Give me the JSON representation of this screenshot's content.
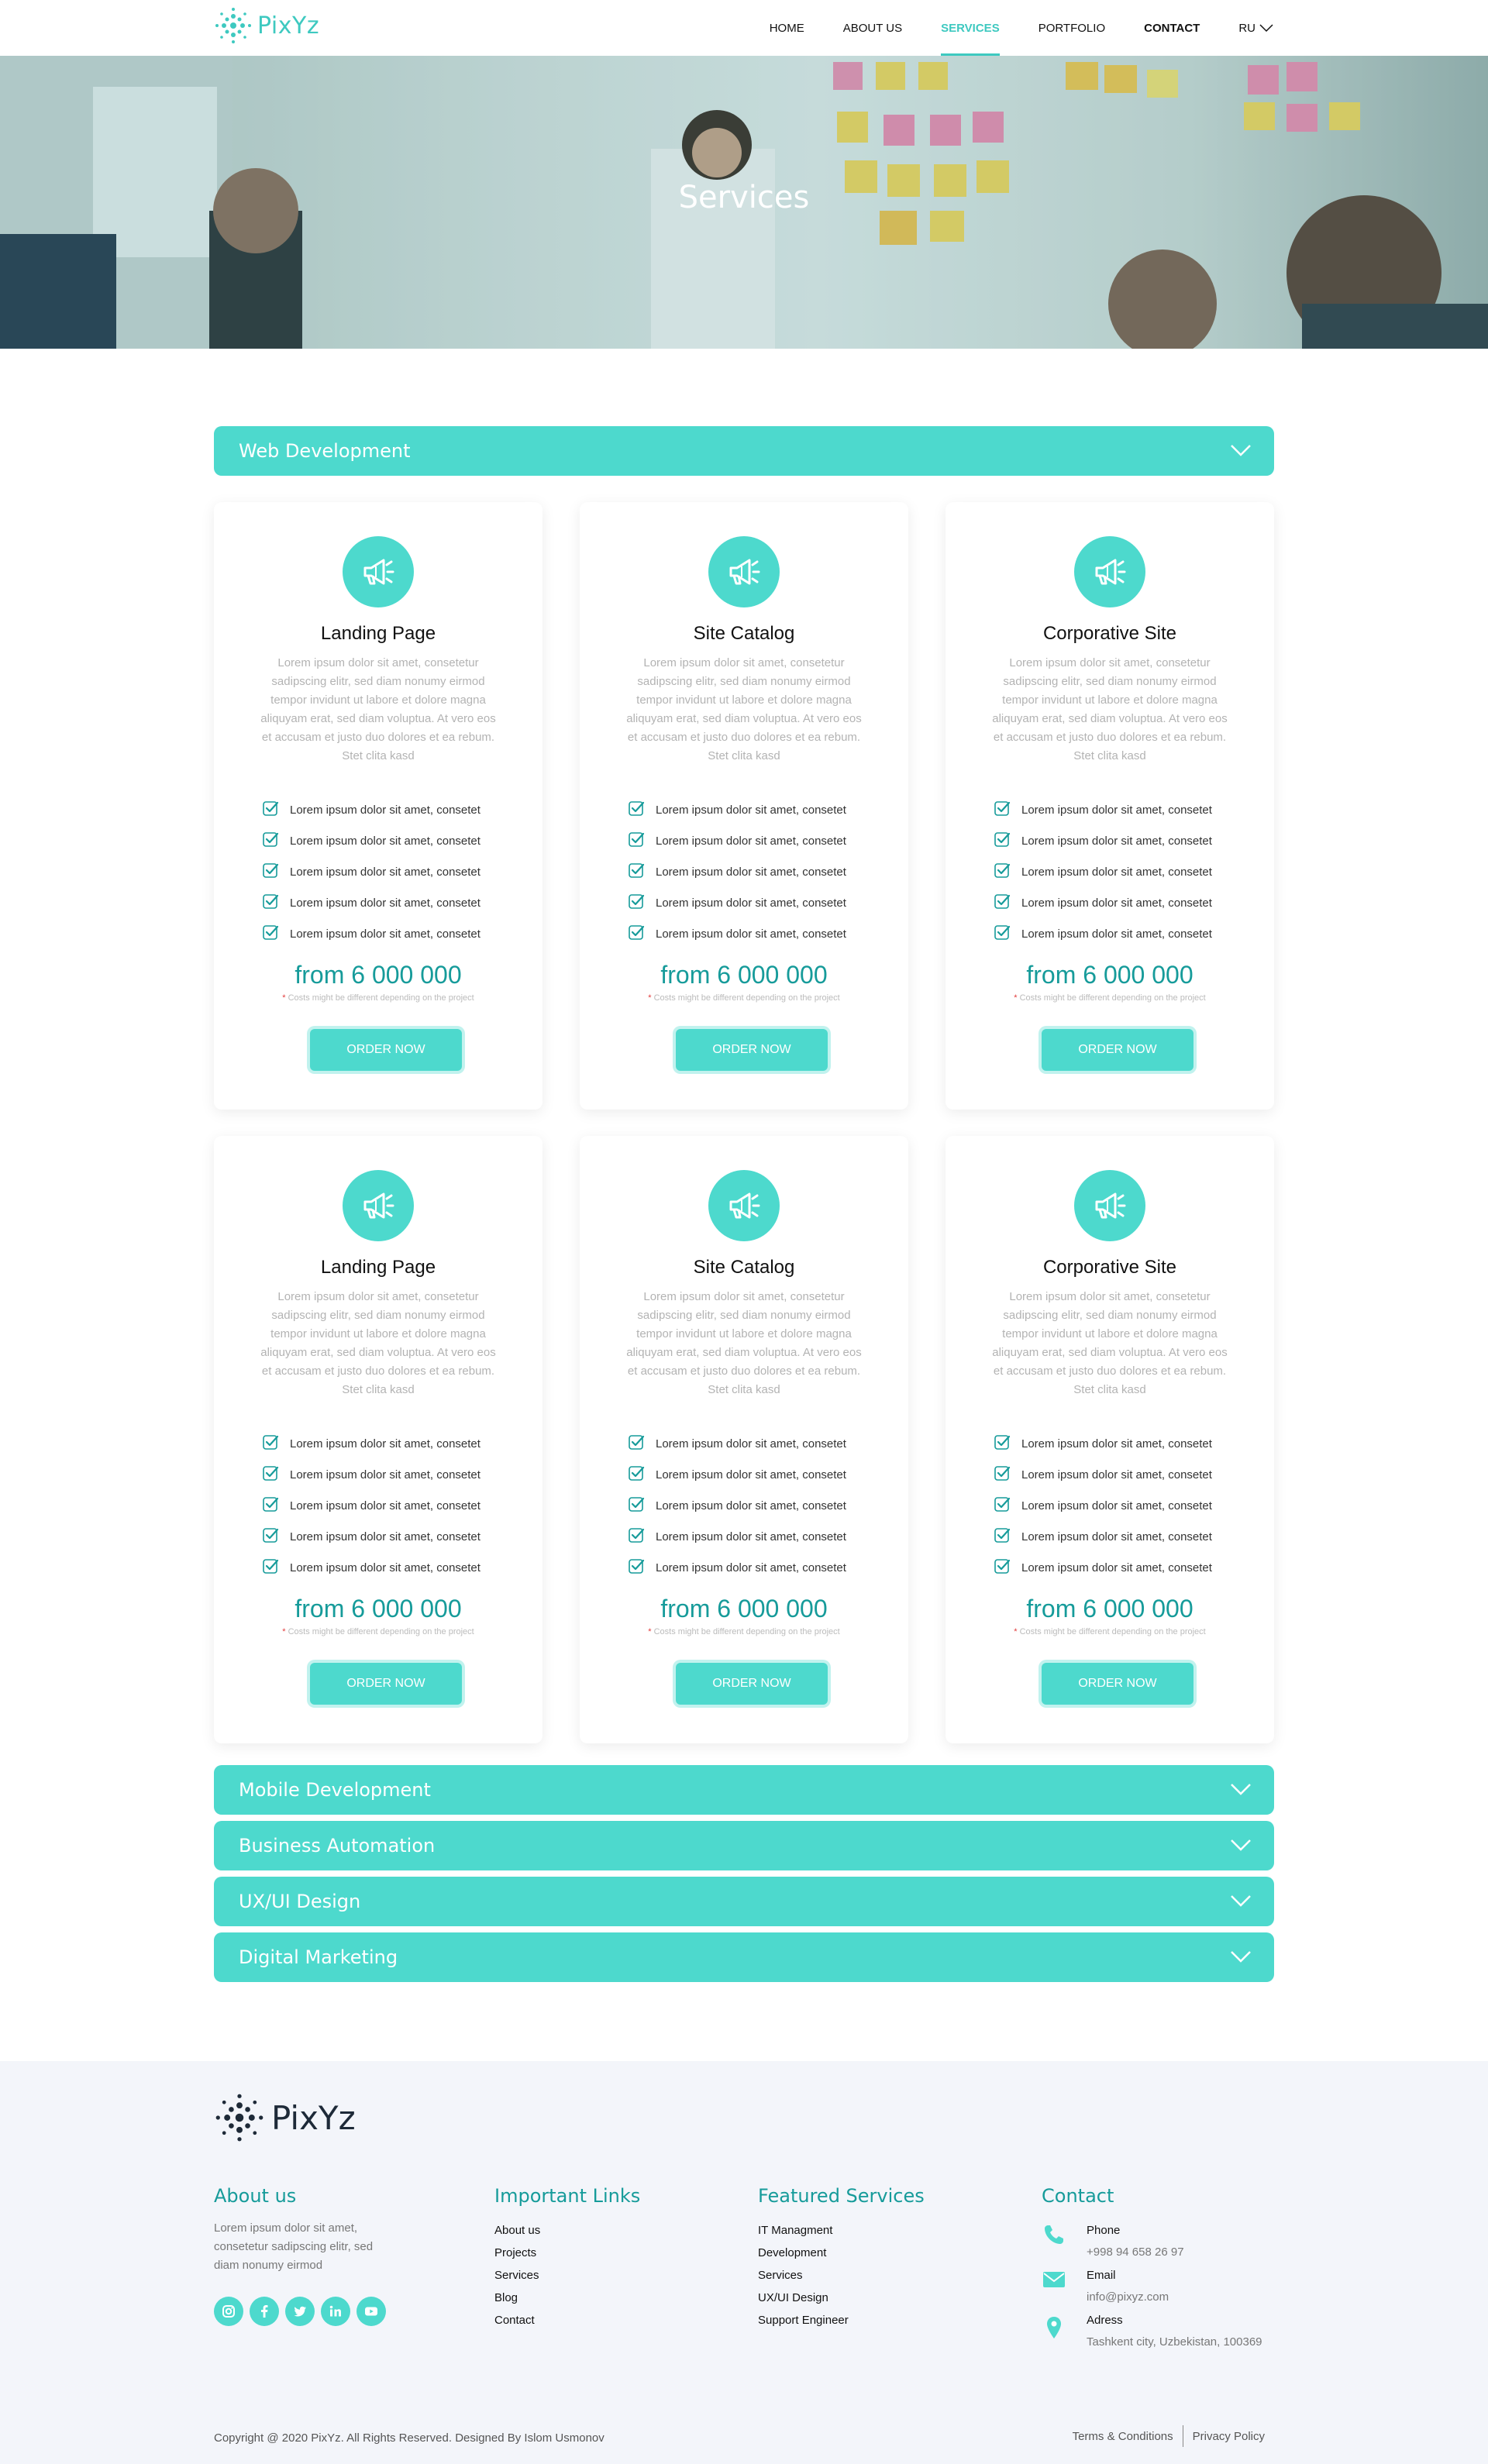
{
  "brand": {
    "name": "PixYz",
    "accent": "#4dd9cd",
    "accent_dark": "#169b9a"
  },
  "nav": {
    "items": [
      {
        "label": "HOME"
      },
      {
        "label": "ABOUT US"
      },
      {
        "label": "SERVICES"
      },
      {
        "label": "PORTFOLIO"
      },
      {
        "label": "CONTACT"
      }
    ],
    "active": "SERVICES",
    "lang": "RU"
  },
  "hero": {
    "title": "Services"
  },
  "sections": [
    {
      "title": "Web Development",
      "expanded": true
    },
    {
      "title": "Mobile Development",
      "expanded": false
    },
    {
      "title": "Business Automation",
      "expanded": false
    },
    {
      "title": "UX/UI Design",
      "expanded": false
    },
    {
      "title": "Digital Marketing",
      "expanded": false
    }
  ],
  "cards": [
    {
      "title": "Landing Page",
      "icon": "megaphone-icon",
      "desc": "Lorem ipsum dolor sit amet, consetetur sadipscing elitr, sed diam nonumy eirmod tempor invidunt ut labore et dolore magna aliquyam erat, sed diam voluptua. At vero eos et accusam et justo duo dolores et ea rebum. Stet clita kasd",
      "features": [
        "Lorem ipsum dolor sit amet, consetet",
        "Lorem ipsum dolor sit amet, consetet",
        "Lorem ipsum dolor sit amet, consetet",
        "Lorem ipsum dolor sit amet, consetet",
        "Lorem ipsum dolor sit amet, consetet"
      ],
      "price": "from 6 000 000",
      "note": "Costs might be different depending on the project",
      "button": "ORDER NOW"
    },
    {
      "title": "Site Catalog",
      "icon": "megaphone-icon",
      "desc": "Lorem ipsum dolor sit amet, consetetur sadipscing elitr, sed diam nonumy eirmod tempor invidunt ut labore et dolore magna aliquyam erat, sed diam voluptua. At vero eos et accusam et justo duo dolores et ea rebum. Stet clita kasd",
      "features": [
        "Lorem ipsum dolor sit amet, consetet",
        "Lorem ipsum dolor sit amet, consetet",
        "Lorem ipsum dolor sit amet, consetet",
        "Lorem ipsum dolor sit amet, consetet",
        "Lorem ipsum dolor sit amet, consetet"
      ],
      "price": "from 6 000 000",
      "note": "Costs might be different depending on the project",
      "button": "ORDER NOW"
    },
    {
      "title": "Corporative Site",
      "icon": "megaphone-icon",
      "desc": "Lorem ipsum dolor sit amet, consetetur sadipscing elitr, sed diam nonumy eirmod tempor invidunt ut labore et dolore magna aliquyam erat, sed diam voluptua. At vero eos et accusam et justo duo dolores et ea rebum. Stet clita kasd",
      "features": [
        "Lorem ipsum dolor sit amet, consetet",
        "Lorem ipsum dolor sit amet, consetet",
        "Lorem ipsum dolor sit amet, consetet",
        "Lorem ipsum dolor sit amet, consetet",
        "Lorem ipsum dolor sit amet, consetet"
      ],
      "price": "from 6 000 000",
      "note": "Costs might be different depending on the project",
      "button": "ORDER NOW"
    },
    {
      "title": "Landing Page",
      "icon": "megaphone-icon",
      "desc": "Lorem ipsum dolor sit amet, consetetur sadipscing elitr, sed diam nonumy eirmod tempor invidunt ut labore et dolore magna aliquyam erat, sed diam voluptua. At vero eos et accusam et justo duo dolores et ea rebum. Stet clita kasd",
      "features": [
        "Lorem ipsum dolor sit amet, consetet",
        "Lorem ipsum dolor sit amet, consetet",
        "Lorem ipsum dolor sit amet, consetet",
        "Lorem ipsum dolor sit amet, consetet",
        "Lorem ipsum dolor sit amet, consetet"
      ],
      "price": "from 6 000 000",
      "note": "Costs might be different depending on the project",
      "button": "ORDER NOW"
    },
    {
      "title": "Site Catalog",
      "icon": "megaphone-icon",
      "desc": "Lorem ipsum dolor sit amet, consetetur sadipscing elitr, sed diam nonumy eirmod tempor invidunt ut labore et dolore magna aliquyam erat, sed diam voluptua. At vero eos et accusam et justo duo dolores et ea rebum. Stet clita kasd",
      "features": [
        "Lorem ipsum dolor sit amet, consetet",
        "Lorem ipsum dolor sit amet, consetet",
        "Lorem ipsum dolor sit amet, consetet",
        "Lorem ipsum dolor sit amet, consetet",
        "Lorem ipsum dolor sit amet, consetet"
      ],
      "price": "from 6 000 000",
      "note": "Costs might be different depending on the project",
      "button": "ORDER NOW"
    },
    {
      "title": "Corporative Site",
      "icon": "megaphone-icon",
      "desc": "Lorem ipsum dolor sit amet, consetetur sadipscing elitr, sed diam nonumy eirmod tempor invidunt ut labore et dolore magna aliquyam erat, sed diam voluptua. At vero eos et accusam et justo duo dolores et ea rebum. Stet clita kasd",
      "features": [
        "Lorem ipsum dolor sit amet, consetet",
        "Lorem ipsum dolor sit amet, consetet",
        "Lorem ipsum dolor sit amet, consetet",
        "Lorem ipsum dolor sit amet, consetet",
        "Lorem ipsum dolor sit amet, consetet"
      ],
      "price": "from 6 000 000",
      "note": "Costs might be different depending on the project",
      "button": "ORDER NOW"
    }
  ],
  "footer": {
    "brand": "PixYz",
    "about": {
      "title": "About us",
      "text": "Lorem ipsum dolor sit amet, consetetur sadipscing elitr, sed diam nonumy eirmod"
    },
    "socials": [
      "instagram-icon",
      "facebook-icon",
      "twitter-icon",
      "linkedin-icon",
      "youtube-icon"
    ],
    "links": {
      "title": "Important Links",
      "items": [
        "About us",
        "Projects",
        "Services",
        "Blog",
        "Contact"
      ]
    },
    "featured": {
      "title": "Featured Services",
      "items": [
        "IT Managment",
        "Development",
        "Services",
        "UX/UI Design",
        "Support Engineer"
      ]
    },
    "contact": {
      "title": "Contact",
      "phone_label": "Phone",
      "phone": "+998 94 658 26 97",
      "email_label": "Email",
      "email": "info@pixyz.com",
      "address_label": "Adress",
      "address": "Tashkent city, Uzbekistan, 100369"
    },
    "copyright": "Copyright @ 2020 PixYz. All Rights Reserved. Designed By Islom Usmonov",
    "terms": "Terms & Conditions",
    "privacy": "Privacy Policy"
  }
}
